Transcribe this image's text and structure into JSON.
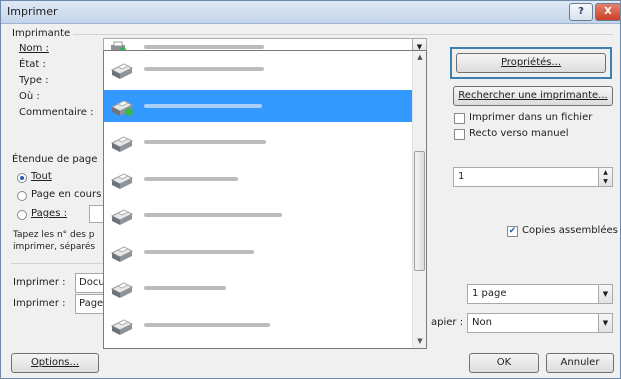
{
  "window": {
    "title": "Imprimer",
    "help_label": "?",
    "close_label": "X"
  },
  "printer_group": {
    "title": "Imprimante",
    "name_label": "Nom :",
    "status_label": "État :",
    "type_label": "Type :",
    "where_label": "Où :",
    "comment_label": "Commentaire :",
    "properties_button": "Propriétés...",
    "find_printer_button": "Rechercher une imprimante...",
    "print_to_file": "Imprimer dans un fichier",
    "manual_duplex": "Recto verso manuel"
  },
  "printer_list": {
    "item_count": 8,
    "selected_index": 1
  },
  "page_range": {
    "title": "Étendue de page",
    "all": "Tout",
    "current_page": "Page en cours",
    "pages": "Pages :",
    "hint_line1": "Tapez les n° des p",
    "hint_line2": "imprimer, séparés"
  },
  "copies": {
    "value": "1",
    "collate": "Copies assemblées"
  },
  "bottom": {
    "print_label_1": "Imprimer :",
    "print_value_1": "Docu",
    "print_label_2": "Imprimer :",
    "print_value_2": "Page",
    "pages_per_sheet": "1 page",
    "paper_label": "apier :",
    "scale_value": "Non"
  },
  "buttons": {
    "options": "Options...",
    "ok": "OK",
    "cancel": "Annuler"
  },
  "colors": {
    "selection": "#3399ff",
    "focus_border": "#3c7fb1"
  }
}
